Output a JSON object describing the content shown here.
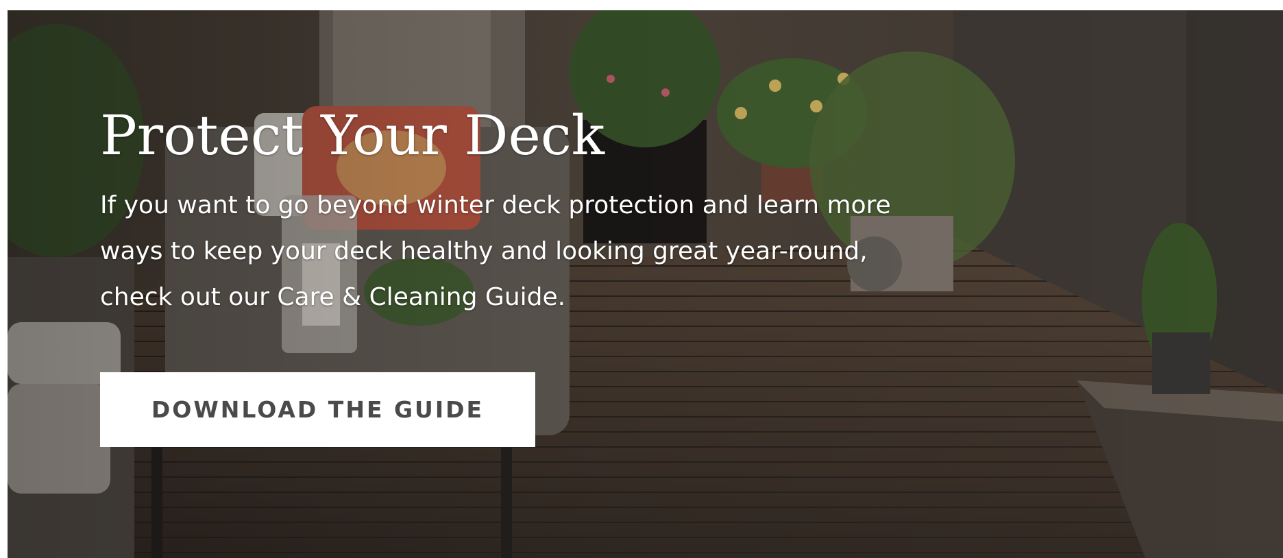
{
  "hero": {
    "title": "Protect Your Deck",
    "body": "If you want to go beyond winter deck protection and learn more ways to keep your deck healthy and looking great year-round, check out our Care & Cleaning Guide.",
    "cta_label": "DOWNLOAD THE GUIDE",
    "background_image": "deck-patio-with-plants-photo"
  },
  "colors": {
    "text": "#ffffff",
    "button_bg": "#ffffff",
    "button_text": "#4a4a4a"
  }
}
